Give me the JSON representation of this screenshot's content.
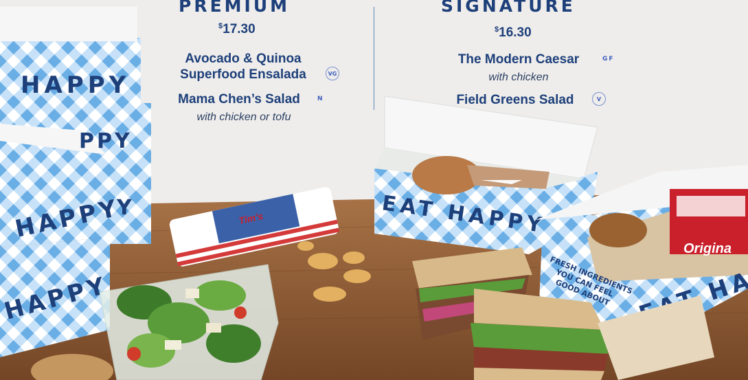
{
  "premium": {
    "heading": "PREMIUM",
    "price_symbol": "$",
    "price": "17.30",
    "items": [
      {
        "name": "Avocado & Quinoa",
        "name_line2": "Superfood Ensalada",
        "tag": "VG"
      },
      {
        "name": "Mama Chen’s Salad",
        "tag": "N",
        "sub": "with chicken or tofu"
      }
    ]
  },
  "signature": {
    "heading": "SIGNATURE",
    "price_symbol": "$",
    "price": "16.30",
    "items": [
      {
        "name": "The Modern Caesar",
        "tag": "GF",
        "sub": "with chicken"
      },
      {
        "name": "Field Greens Salad",
        "tag": "V"
      }
    ]
  },
  "photo": {
    "box_text_left": "HAPPY",
    "box_text_center": "EAT HAPPY",
    "box_text_right": "EAT HAP",
    "box_slogan": [
      "FRESH INGREDIENTS",
      "YOU CAN FEEL",
      "GOOD ABOUT"
    ],
    "chips_label": "Tim's"
  },
  "colors": {
    "heading": "#1d3f7a",
    "badge": "#3f5fbf",
    "wood": "#8a5a35",
    "box_blue": "#7ab6e8"
  }
}
